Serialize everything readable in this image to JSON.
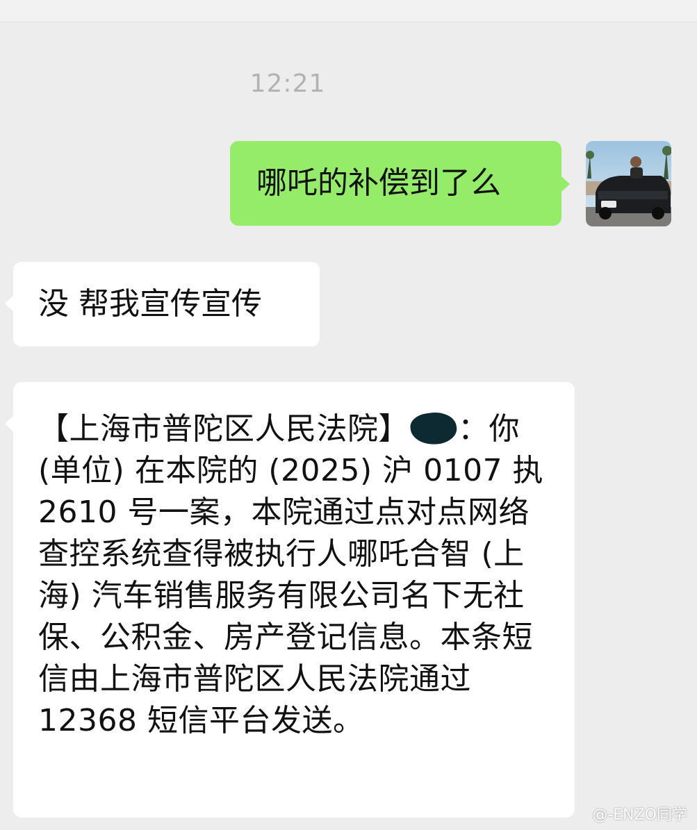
{
  "chat": {
    "timestamp": "12:21",
    "messages": [
      {
        "sender": "self",
        "text": "哪吒的补偿到了么"
      },
      {
        "sender": "other",
        "text": "没 帮我宣传宣传"
      },
      {
        "sender": "other",
        "text_before_redaction": "【上海市普陀区人民法院】",
        "text_after_redaction": "：你(单位) 在本院的 (2025) 沪 0107 执 2610 号一案，本院通过点对点网络查控系统查得被执行人哪吒合智 (上海) 汽车销售服务有限公司名下无社保、公积金、房产登记信息。本条短信由上海市普陀区人民法院通过 12368 短信平台发送。"
      }
    ]
  },
  "avatar": {
    "description_icon": "avatar-photo-icon"
  },
  "watermark": {
    "text": "@-ENZO同学"
  },
  "colors": {
    "background": "#ededed",
    "sent_bubble": "#95ec69",
    "received_bubble": "#ffffff",
    "timestamp": "#b2b2b2"
  }
}
